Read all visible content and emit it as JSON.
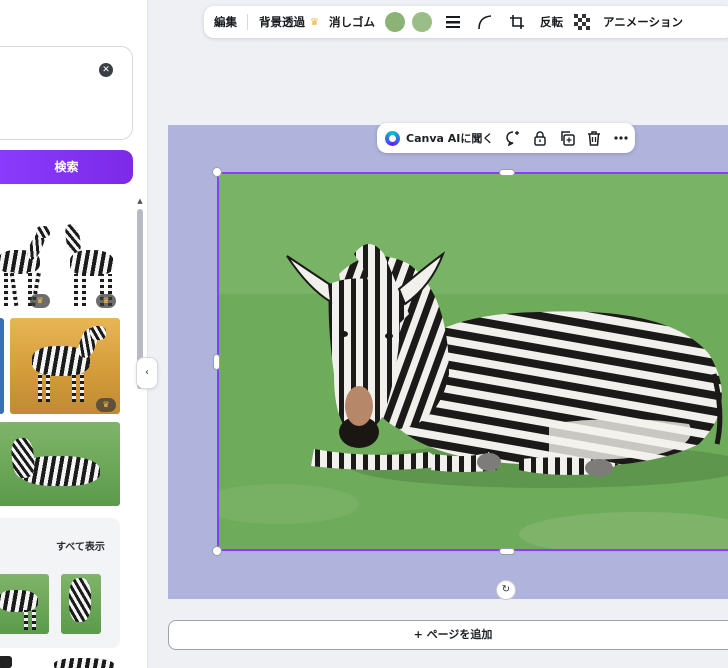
{
  "left_panel": {
    "search_button_label": "検索",
    "see_all_label": "すべて表示",
    "clear_icon": "close-circle-icon",
    "collapse_icon": "chevron-left-icon",
    "premium_icon": "crown-icon"
  },
  "toolbar": {
    "edit_label": "編集",
    "bg_remove_label": "背景透過",
    "eraser_label": "消しゴム",
    "flip_label": "反転",
    "animation_label": "アニメーション",
    "colors": [
      "#8bb375",
      "#9bbd87"
    ],
    "icons": [
      "lines-icon",
      "corner-radius-icon",
      "crop-icon",
      "transparency-icon"
    ]
  },
  "context_bar": {
    "ai_label": "Canva AIに聞く",
    "icons": [
      "comment-add-icon",
      "lock-icon",
      "duplicate-icon",
      "trash-icon",
      "more-icon"
    ]
  },
  "canvas": {
    "add_page_label": "+ ページを追加",
    "rotate_icon": "rotate-icon"
  }
}
